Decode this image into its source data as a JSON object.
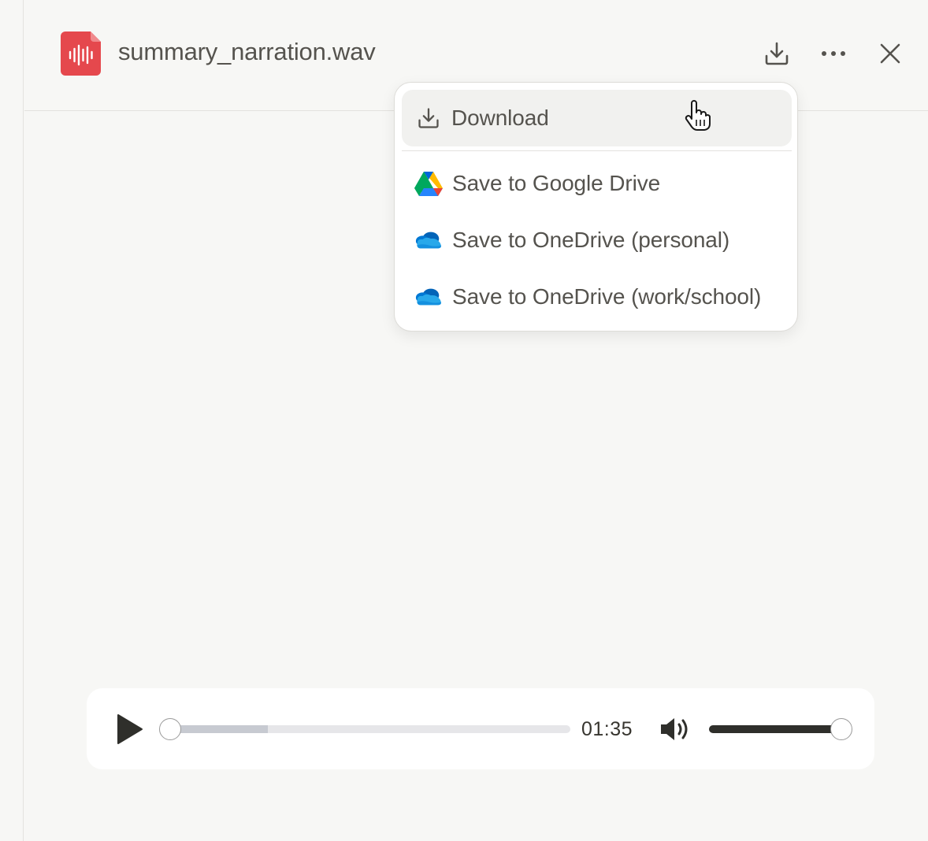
{
  "header": {
    "file_name": "summary_narration.wav",
    "file_icon": "audio-file-icon",
    "actions": {
      "download_icon": "download-icon",
      "more_icon": "more-horizontal-icon",
      "close_icon": "close-icon"
    }
  },
  "menu": {
    "items": [
      {
        "label": "Download",
        "icon": "download-icon",
        "highlighted": true
      },
      {
        "label": "Save to Google Drive",
        "icon": "google-drive-icon"
      },
      {
        "label": "Save to OneDrive (personal)",
        "icon": "onedrive-icon"
      },
      {
        "label": "Save to OneDrive (work/school)",
        "icon": "onedrive-icon"
      }
    ]
  },
  "player": {
    "play_icon": "play-icon",
    "position_fraction": 0.0,
    "buffered_fraction": 0.25,
    "duration": "01:35",
    "volume_icon": "volume-icon",
    "volume_fraction": 1.0
  },
  "colors": {
    "accent_audio": "#e5484d",
    "background": "#f7f7f5",
    "menu_hover": "#f1f1ef"
  }
}
